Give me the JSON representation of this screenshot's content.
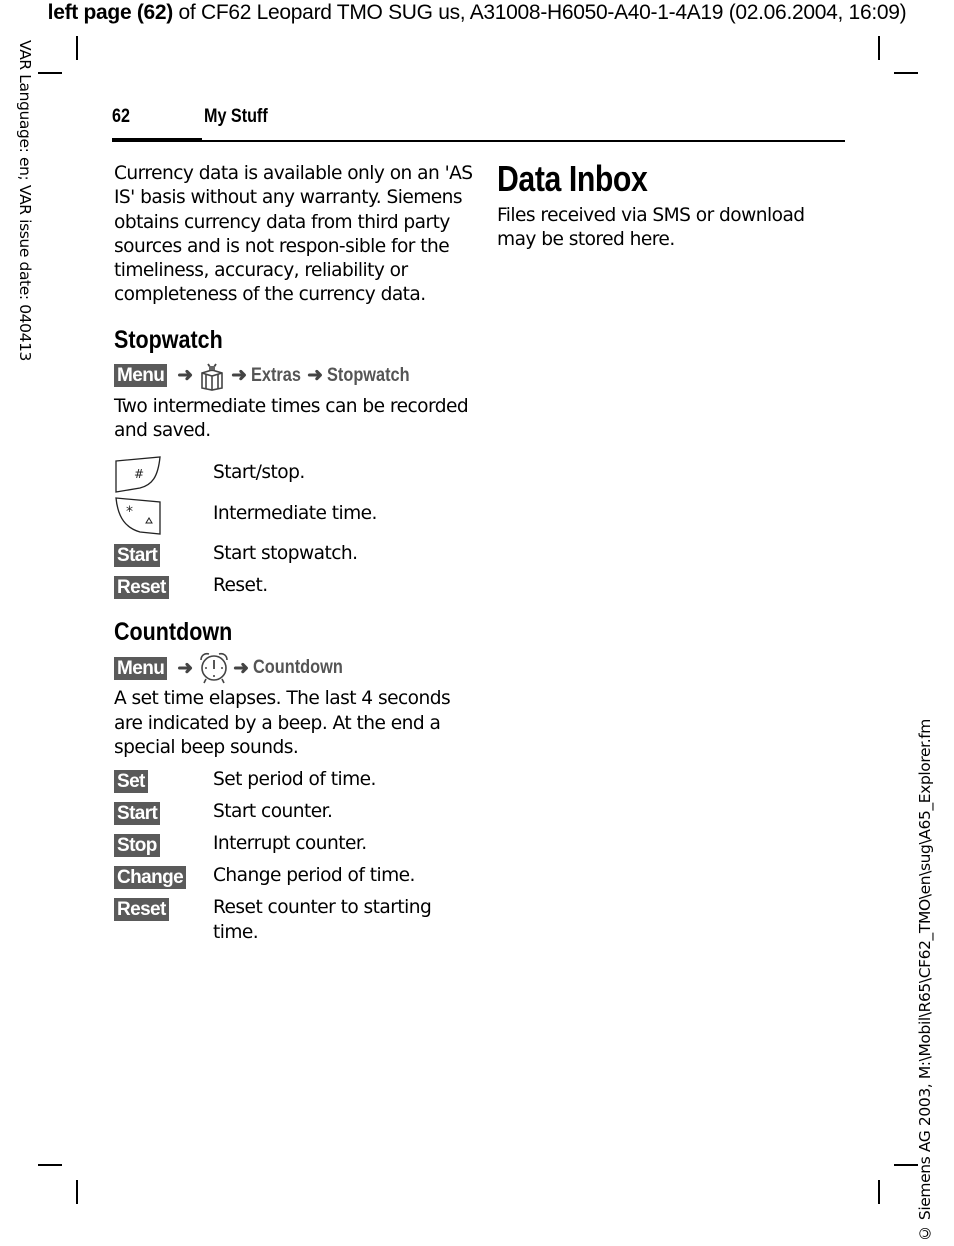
{
  "top_header": {
    "bold": "left page (62)",
    "rest": " of CF62 Leopard TMO SUG us, A31008-H6050-A40-1-4A19 (02.06.2004, 16:09)"
  },
  "side_left": "VAR Language: en; VAR issue date: 040413",
  "side_right": "© Siemens AG 2003, M:\\Mobil\\R65\\CF62_TMO\\en\\sug\\A65_Explorer.fm",
  "running_head": {
    "page_number": "62",
    "section": "My Stuff"
  },
  "left_column": {
    "intro": "Currency data is available only on an 'AS IS' basis without any warranty. Siemens obtains currency data from third party sources and is not respon-sible for the timeliness, accuracy, reliability or completeness of the currency data.",
    "stopwatch": {
      "heading": "Stopwatch",
      "path": {
        "menu": "Menu",
        "icon": "gift-icon",
        "steps": [
          "Extras",
          "Stopwatch"
        ],
        "arrow": "➜"
      },
      "description": "Two intermediate times can be recorded and saved.",
      "keys": [
        {
          "icon": "hash-key-icon",
          "symbol": "#",
          "desc": "Start/stop."
        },
        {
          "icon": "star-key-icon",
          "symbol": "*",
          "desc": "Intermediate time."
        },
        {
          "softkey": "Start",
          "desc": "Start stopwatch."
        },
        {
          "softkey": "Reset",
          "desc": "Reset."
        }
      ]
    },
    "countdown": {
      "heading": "Countdown",
      "path": {
        "menu": "Menu",
        "icon": "alarm-clock-icon",
        "steps": [
          "Countdown"
        ],
        "arrow": "➜"
      },
      "description": "A set time elapses. The last 4 seconds are indicated by a beep. At the end a special beep sounds.",
      "keys": [
        {
          "softkey": "Set",
          "desc": "Set period of time."
        },
        {
          "softkey": "Start",
          "desc": "Start counter."
        },
        {
          "softkey": "Stop",
          "desc": "Interrupt counter."
        },
        {
          "softkey": "Change",
          "desc": "Change period of time."
        },
        {
          "softkey": "Reset",
          "desc": "Reset counter to starting time."
        }
      ]
    }
  },
  "right_column": {
    "heading": "Data Inbox",
    "text": "Files received via SMS or download may be stored here."
  }
}
